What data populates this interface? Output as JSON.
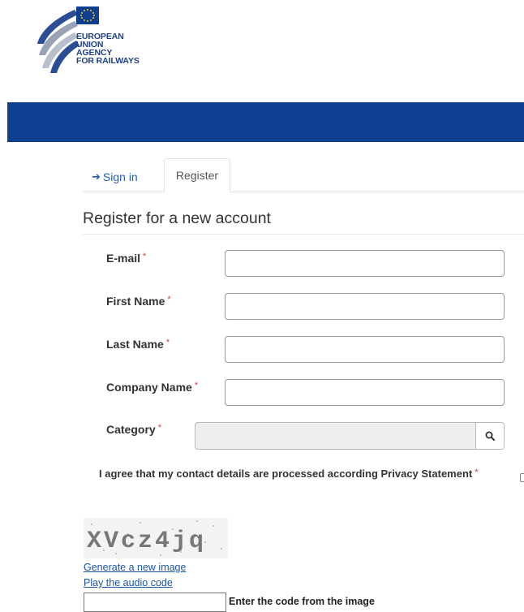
{
  "logo": {
    "line1": "EUROPEAN",
    "line2": "UNION",
    "line3": "AGENCY",
    "line4": "FOR RAILWAYS"
  },
  "colors": {
    "brand_blue": "#0e3f91",
    "link": "#1a55a8",
    "required": "#d43f3a"
  },
  "tabs": [
    {
      "label": "Sign in",
      "icon": "sign-in-icon",
      "active": false
    },
    {
      "label": "Register",
      "active": true
    }
  ],
  "heading": "Register for a new account",
  "fields": {
    "email": {
      "label": "E-mail",
      "required_mark": "*",
      "value": ""
    },
    "first_name": {
      "label": "First Name",
      "required_mark": "*",
      "value": ""
    },
    "last_name": {
      "label": "Last Name",
      "required_mark": "*",
      "value": ""
    },
    "company_name": {
      "label": "Company Name",
      "required_mark": "*",
      "value": ""
    },
    "category": {
      "label": "Category",
      "required_mark": "*",
      "value": "",
      "button_icon": "search-icon"
    }
  },
  "agreement": {
    "label": "I agree that my contact details are processed according Privacy Statement",
    "required_mark": "*",
    "checked": false
  },
  "captcha": {
    "image_text": "XVcz4jq",
    "generate_link": "Generate a new image",
    "audio_link": "Play the audio code",
    "input_value": "",
    "input_label": "Enter the code from the image"
  }
}
